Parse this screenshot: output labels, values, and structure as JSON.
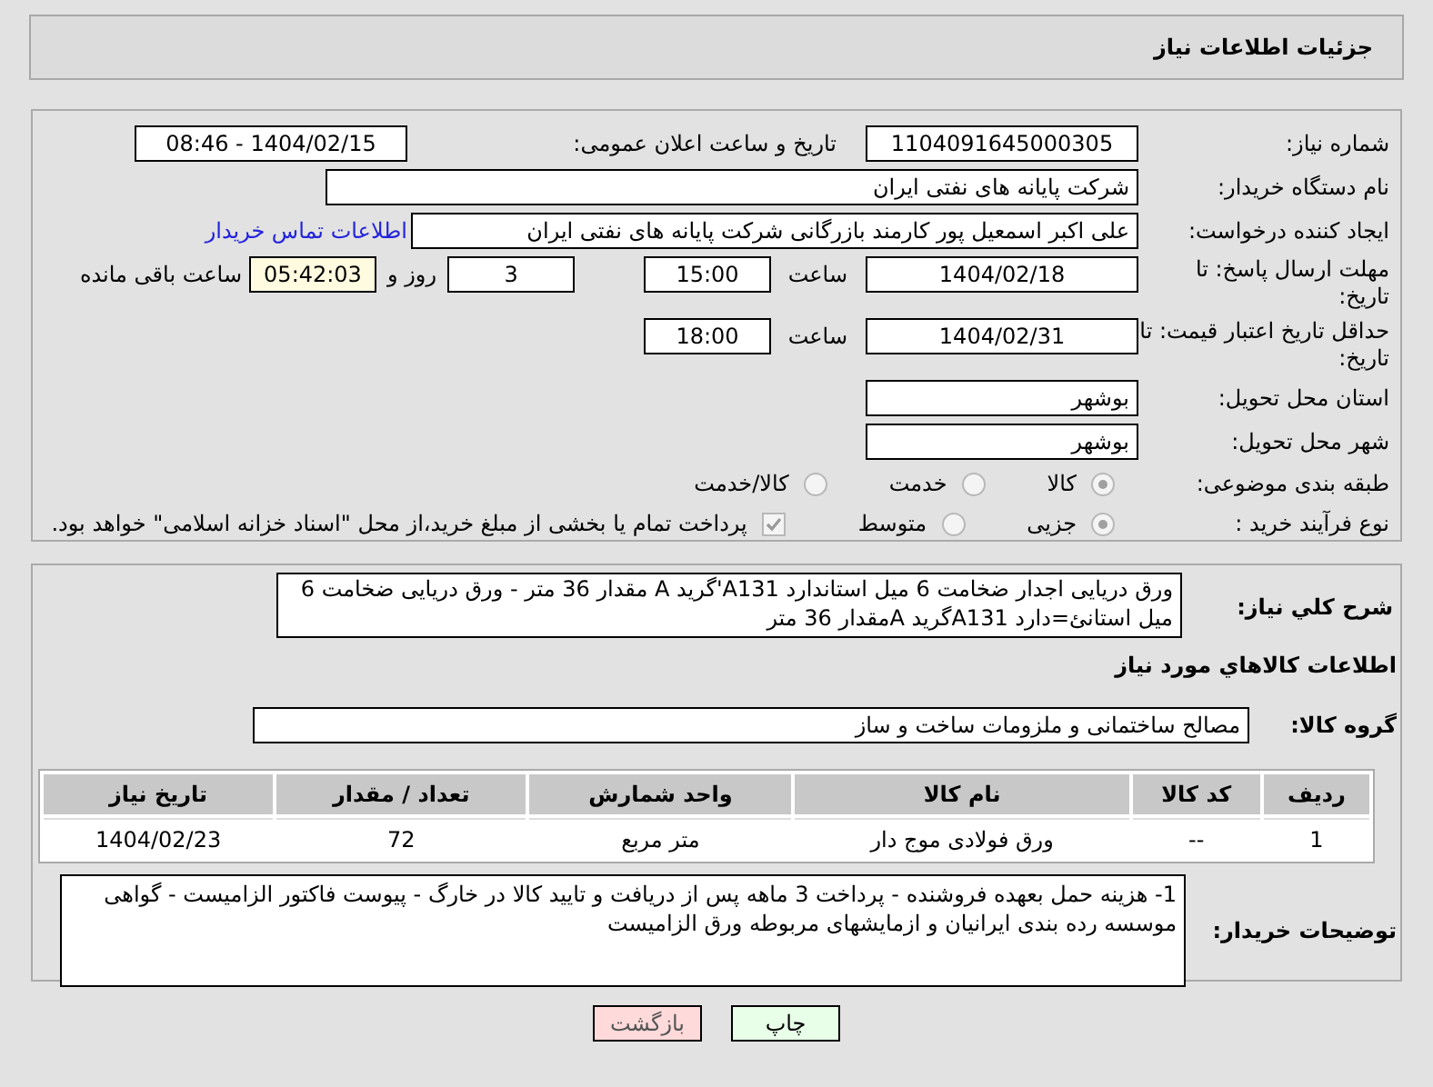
{
  "header": {
    "title": "جزئیات اطلاعات نیاز"
  },
  "need_number": {
    "label": "شماره نیاز:",
    "value": "1104091645000305"
  },
  "announce": {
    "label": "تاریخ و ساعت اعلان عمومی:",
    "value": "1404/02/15 - 08:46"
  },
  "buyer": {
    "label": "نام دستگاه خریدار:",
    "value": "شرکت پایانه های نفتی ایران"
  },
  "creator": {
    "label": "ایجاد کننده درخواست:",
    "value": "علی اکبر اسمعیل پور کارمند بازرگانی شرکت پایانه های نفتی ایران",
    "link": "اطلاعات تماس خریدار"
  },
  "deadline": {
    "label": "مهلت ارسال پاسخ: تا تاریخ:",
    "date": "1404/02/18",
    "time_label": "ساعت",
    "time": "15:00",
    "days": "3",
    "days_label": "روز و",
    "remaining": "05:42:03",
    "remaining_label": "ساعت باقی مانده"
  },
  "validity": {
    "label": "حداقل تاریخ اعتبار قیمت: تا تاریخ:",
    "date": "1404/02/31",
    "time_label": "ساعت",
    "time": "18:00"
  },
  "province": {
    "label": "استان محل تحویل:",
    "value": "بوشهر"
  },
  "city": {
    "label": "شهر محل تحویل:",
    "value": "بوشهر"
  },
  "category": {
    "label": "طبقه بندی موضوعی:",
    "options": [
      {
        "label": "کالا",
        "selected": true
      },
      {
        "label": "خدمت",
        "selected": false
      },
      {
        "label": "کالا/خدمت",
        "selected": false
      }
    ]
  },
  "process": {
    "label": "نوع فرآیند خرید :",
    "options": [
      {
        "label": "جزیی",
        "selected": true
      },
      {
        "label": "متوسط",
        "selected": false
      }
    ],
    "payment": {
      "label": "پرداخت تمام یا بخشی از مبلغ خرید،از محل \"اسناد خزانه اسلامی\" خواهد بود.",
      "checked": true
    }
  },
  "summary": {
    "label": "شرح کلي نياز:",
    "value": "ورق دریایی اجدار  ضخامت 6 میل  استاندارد A131'گرید A مقدار 36 متر - ورق دریایی ضخامت 6 میل استانئ=دارد A131گرید Aمقدار 36 متر"
  },
  "goods_title": "اطلاعات كالاهاي مورد نياز",
  "goods_group": {
    "label": "گروه کالا:",
    "value": "مصالح ساختمانی و ملزومات ساخت و ساز"
  },
  "table": {
    "columns": [
      "ردیف",
      "کد کالا",
      "نام کالا",
      "واحد شمارش",
      "تعداد / مقدار",
      "تاریخ نیاز"
    ],
    "rows": [
      [
        "1",
        "--",
        "ورق فولادی موج دار",
        "متر مربع",
        "72",
        "1404/02/23"
      ]
    ]
  },
  "notes": {
    "label": "توضیحات خریدار:",
    "value": "1- هزینه حمل بعهده فروشنده - پرداخت 3 ماهه  پس از دریافت و تایید کالا در خارگ - پیوست فاکتور الزامیست - گواهی موسسه رده  بندی ایرانیان و ازمایشهای مربوطه ورق الزامیست"
  },
  "buttons": [
    {
      "label": "چاپ",
      "kind": "print"
    },
    {
      "label": "بازگشت",
      "kind": "back"
    }
  ]
}
